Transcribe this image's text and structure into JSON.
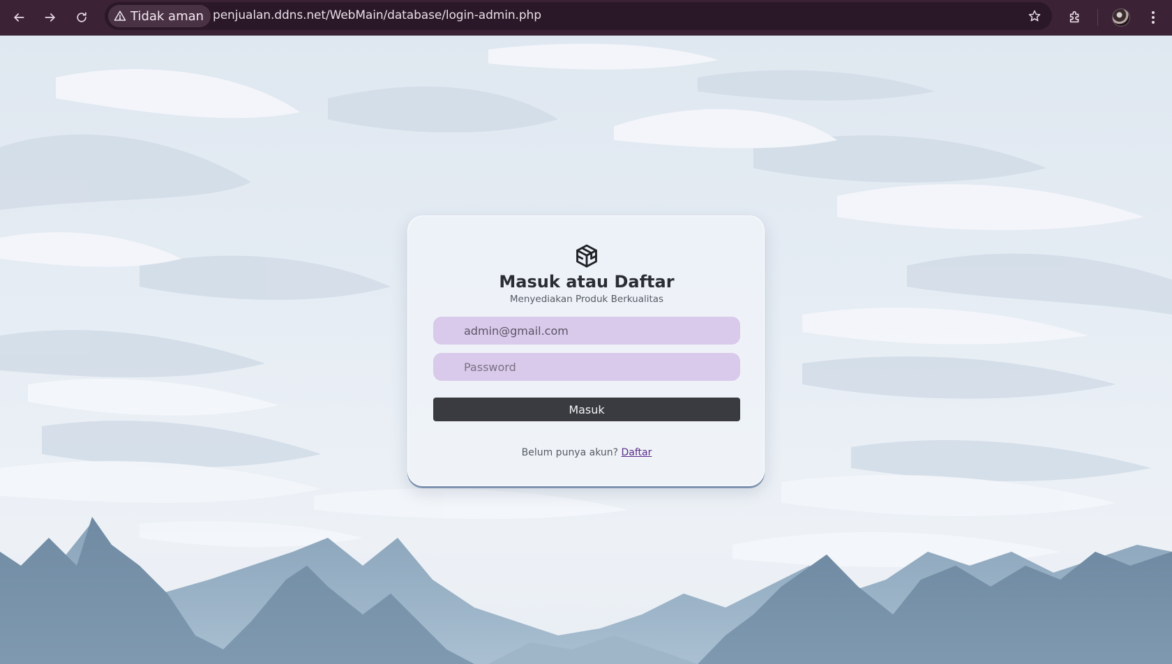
{
  "browser": {
    "security_label": "Tidak aman",
    "url": "penjualan.ddns.net/WebMain/database/login-admin.php",
    "icons": {
      "back": "arrow-left-icon",
      "forward": "arrow-right-icon",
      "reload": "reload-icon",
      "warning": "warning-triangle-icon",
      "bookmark": "star-icon",
      "extensions": "puzzle-icon",
      "profile": "avatar",
      "menu": "kebab-menu-icon"
    },
    "colors": {
      "toolbar": "#3b2235",
      "omnibox": "#2a1828"
    }
  },
  "login": {
    "logo_icon": "cube-icon",
    "title": "Masuk atau Daftar",
    "subtitle": "Menyediakan Produk Berkualitas",
    "email_value": "admin@gmail.com",
    "password_placeholder": "Password",
    "submit_label": "Masuk",
    "register_prompt": "Belum punya akun?",
    "register_link": "Daftar",
    "colors": {
      "input_bg": "#d9c9ea",
      "button_bg": "#393b40",
      "link": "#5a2b8a"
    }
  }
}
